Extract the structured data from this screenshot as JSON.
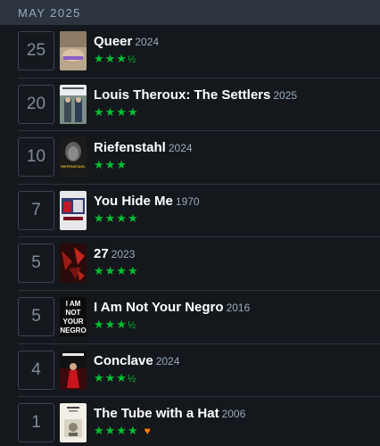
{
  "month_header": "MAY 2025",
  "entries": [
    {
      "day": "25",
      "title": "Queer",
      "year": "2024",
      "stars": "★★★",
      "half": "½",
      "poster": "queer"
    },
    {
      "day": "20",
      "title": "Louis Theroux: The Settlers",
      "year": "2025",
      "stars": "★★★★",
      "half": "",
      "poster": "settlers"
    },
    {
      "day": "10",
      "title": "Riefenstahl",
      "year": "2024",
      "stars": "★★★",
      "half": "",
      "poster": "riefenstahl",
      "poster_text": "RIEFENSTAHL"
    },
    {
      "day": "7",
      "title": "You Hide Me",
      "year": "1970",
      "stars": "★★★★",
      "half": "",
      "poster": "hideme"
    },
    {
      "day": "5",
      "title": "27",
      "year": "2023",
      "stars": "★★★★",
      "half": "",
      "poster": "twentyseven"
    },
    {
      "day": "5",
      "title": "I Am Not Your Negro",
      "year": "2016",
      "stars": "★★★",
      "half": "½",
      "poster": "negro",
      "poster_text": [
        "I AM",
        "NOT",
        "YOUR",
        "NEGRO"
      ]
    },
    {
      "day": "4",
      "title": "Conclave",
      "year": "2024",
      "stars": "★★★",
      "half": "½",
      "poster": "conclave"
    },
    {
      "day": "1",
      "title": "The Tube with a Hat",
      "year": "2006",
      "stars": "★★★★",
      "half": "",
      "liked": true,
      "like_glyph": "♥",
      "poster": "tube"
    }
  ],
  "colors": {
    "star_green": "#00c030",
    "like_orange": "#ff8000"
  }
}
